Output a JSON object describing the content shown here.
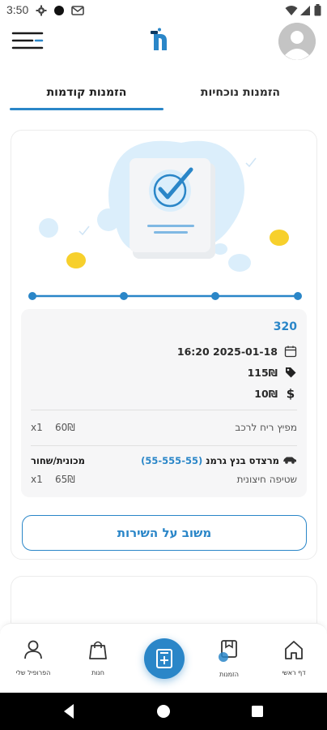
{
  "status_bar": {
    "time": "3:50"
  },
  "header": {
    "menu_icon": "menu-lines-icon",
    "logo_icon": "app-logo-icon",
    "avatar_icon": "user-avatar-icon"
  },
  "tabs": [
    {
      "label": "הזמנות נוכחיות",
      "active": false
    },
    {
      "label": "הזמנות קודמות",
      "active": true
    }
  ],
  "order": {
    "number": "320",
    "datetime": "2025-01-18 16:20",
    "subtotal": "115₪",
    "tip": "10₪",
    "services": [
      {
        "name": "מפיץ ריח לרכב",
        "price": "60₪",
        "qty": "x1"
      }
    ],
    "car": {
      "name": "מרצדס בנץ גרמנ",
      "phone": "(55-555-55)",
      "type": "מכונית/שחור"
    },
    "car_services": [
      {
        "name": "שטיפה חיצונית",
        "price": "65₪",
        "qty": "x1"
      }
    ],
    "feedback_label": "משוב על השירות"
  },
  "bottom_nav": [
    {
      "label": "דף ראשי",
      "icon": "home-icon"
    },
    {
      "label": "הזמנות",
      "icon": "orders-icon"
    },
    {
      "label": "חנות",
      "icon": "shopping-bag-icon"
    },
    {
      "label": "הפרופיל שלי",
      "icon": "profile-icon"
    }
  ],
  "colors": {
    "accent": "#2a86c8",
    "accent_light": "#dbeefb",
    "yellow": "#f7d02c"
  }
}
